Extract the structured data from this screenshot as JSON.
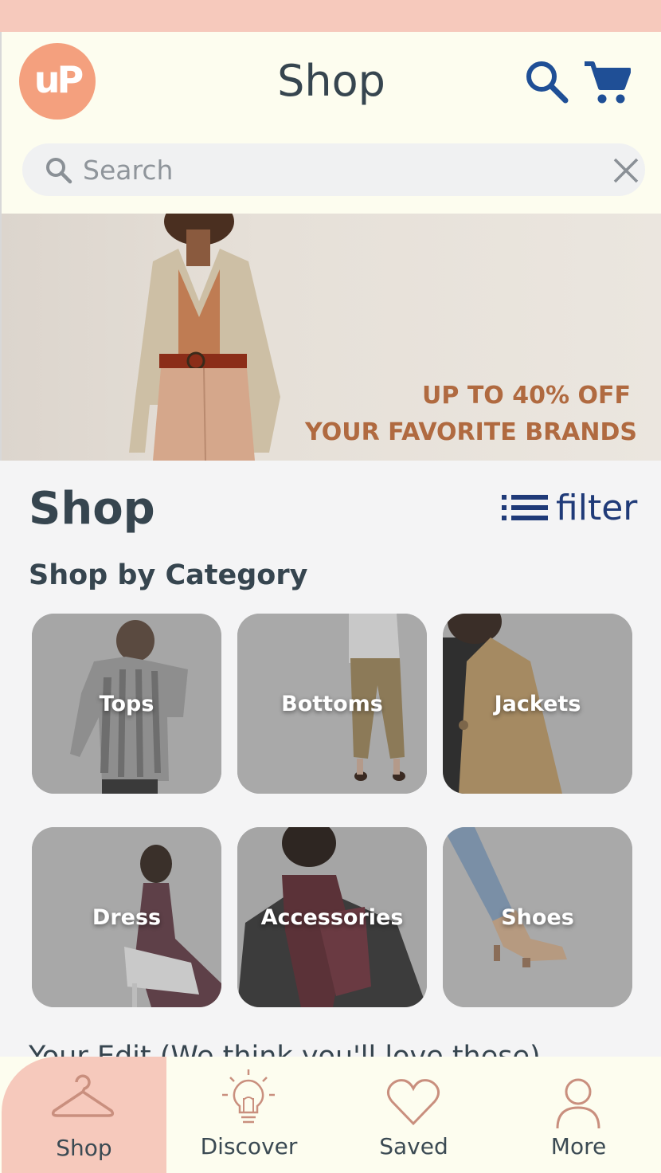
{
  "colors": {
    "status_bar": "#f6c9bc",
    "header_bg": "#fdfdef",
    "logo": "#f4a07e",
    "accent_blue": "#1f3a78",
    "promo_text": "#b06a40",
    "active_nav": "#f6c9bc",
    "nav_icon": "#c98f7e"
  },
  "header": {
    "logo_text": "uP",
    "title": "Shop",
    "search_icon": "search-icon",
    "cart_icon": "cart-icon"
  },
  "search": {
    "placeholder": "Search",
    "icon": "search-icon",
    "clear_icon": "close-icon"
  },
  "hero": {
    "line1": "UP TO 40% OFF",
    "line2": "YOUR FAVORITE BRANDS"
  },
  "main": {
    "title": "Shop",
    "filter_label": "filter",
    "filter_icon": "list-icon",
    "category_heading": "Shop by Category",
    "categories": [
      {
        "label": "Tops"
      },
      {
        "label": "Bottoms"
      },
      {
        "label": "Jackets"
      },
      {
        "label": "Dress"
      },
      {
        "label": "Accessories"
      },
      {
        "label": "Shoes"
      }
    ],
    "next_section_heading": "Your Edit (We think you'll love these)"
  },
  "bottom_nav": {
    "items": [
      {
        "label": "Shop",
        "icon": "hanger-icon",
        "active": true
      },
      {
        "label": "Discover",
        "icon": "lightbulb-icon",
        "active": false
      },
      {
        "label": "Saved",
        "icon": "heart-icon",
        "active": false
      },
      {
        "label": "More",
        "icon": "user-icon",
        "active": false
      }
    ]
  }
}
